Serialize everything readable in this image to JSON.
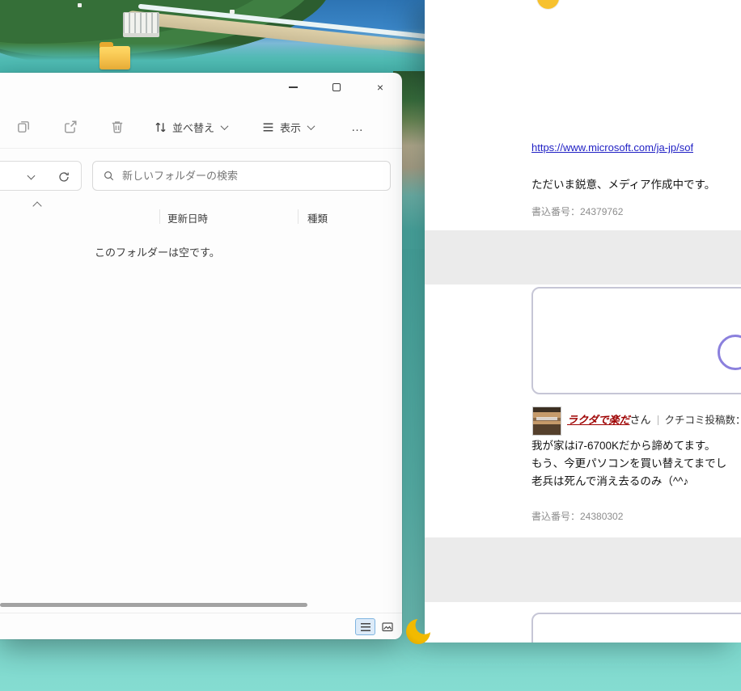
{
  "explorer": {
    "caption": {
      "close_glyph": "×"
    },
    "toolbar": {
      "sort_label": "並べ替え",
      "view_label": "表示",
      "more_glyph": "…"
    },
    "address": {
      "search_placeholder": "新しいフォルダーの検索"
    },
    "columns": {
      "modified": "更新日時",
      "type": "種類"
    },
    "empty_message": "このフォルダーは空です。"
  },
  "forum": {
    "post1": {
      "link": "https://www.microsoft.com/ja-jp/sof",
      "body": "ただいま鋭意、メディア作成中です。",
      "number": "書込番号：24379762"
    },
    "post2": {
      "username": "ラクダで楽だ",
      "suffix": "さん",
      "meta": "クチコミ投稿数：",
      "lines": [
        "我が家はi7-6700Kだから諦めてます。",
        "もう、今更パソコンを買い替えてまでし",
        "老兵は死んで消え去るのみ（^^♪"
      ],
      "number": "書込番号：24380302"
    }
  },
  "colors": {
    "accent": "#0067c0",
    "link_blue": "#1f1fc4",
    "username_red": "#9e0000",
    "teal": "#45b2ab"
  }
}
